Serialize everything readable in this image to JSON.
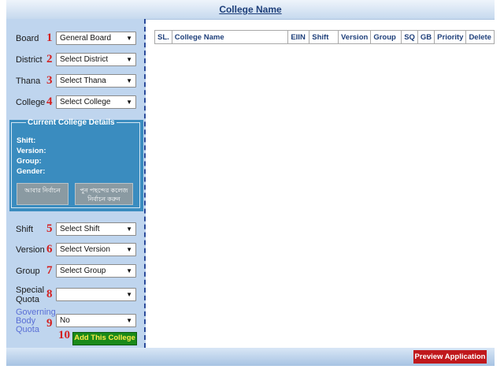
{
  "header": {
    "title": "College Name"
  },
  "sidebar": {
    "board": {
      "label": "Board",
      "num": "1",
      "value": "General Board"
    },
    "district": {
      "label": "District",
      "num": "2",
      "value": "Select District"
    },
    "thana": {
      "label": "Thana",
      "num": "3",
      "value": "Select Thana"
    },
    "college": {
      "label": "College",
      "num": "4",
      "value": "Select College"
    },
    "details": {
      "legend": "Current College Details",
      "shift": "Shift:",
      "version": "Version:",
      "group": "Group:",
      "gender": "Gender:",
      "btn1": "আবার নির্বাচন",
      "btn2": "পুন পছন্দের কলেজ নির্বাচন করুন"
    },
    "shift": {
      "label": "Shift",
      "num": "5",
      "value": "Select Shift"
    },
    "version": {
      "label": "Version",
      "num": "6",
      "value": "Select Version"
    },
    "group": {
      "label": "Group",
      "num": "7",
      "value": "Select Group"
    },
    "special_quota": {
      "label1": "Special",
      "label2": "Quota",
      "num": "8",
      "value": ""
    },
    "governing_quota": {
      "label1": "Governing",
      "label2": "Body",
      "label3": "Quota",
      "num": "9",
      "value": "No"
    },
    "add": {
      "num": "10",
      "label": "Add This College"
    }
  },
  "table": {
    "columns": [
      "SL.",
      "College Name",
      "EIIN",
      "Shift",
      "Version",
      "Group",
      "SQ",
      "GB",
      "Priority",
      "Delete"
    ]
  },
  "footer": {
    "preview_label": "Preview Application"
  },
  "colors": {
    "accent": "#1e3f7a",
    "sidebar": "#bfd5ee",
    "details": "#3a8cbf",
    "add": "#1a8a1a",
    "preview": "#c0181c"
  }
}
